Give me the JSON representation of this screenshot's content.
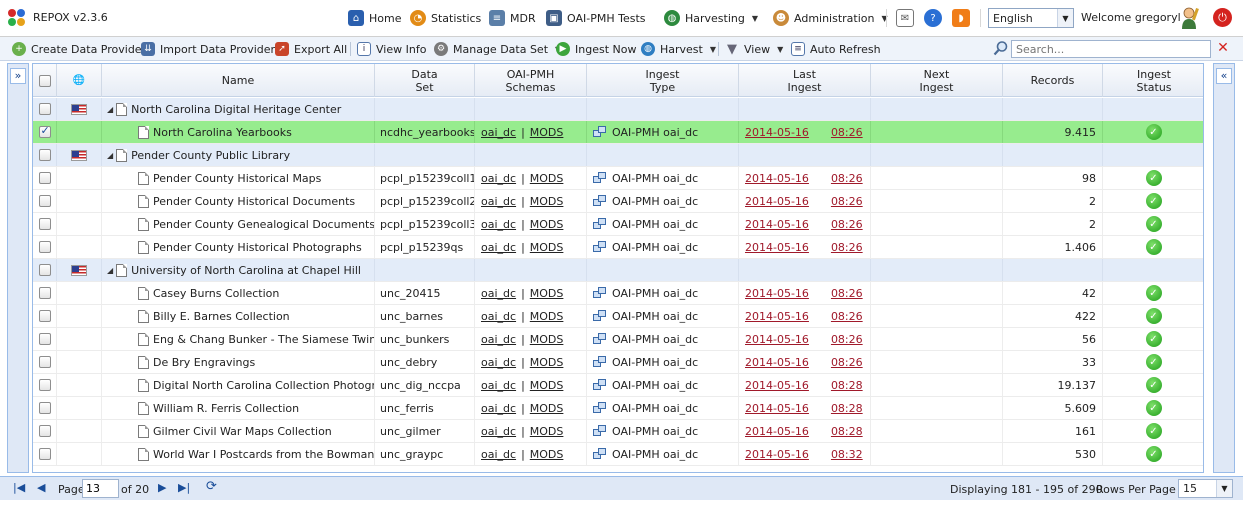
{
  "app": {
    "title": "REPOX v2.3.6"
  },
  "nav": [
    {
      "label": "Home",
      "icon": "home-icon"
    },
    {
      "label": "Statistics",
      "icon": "statistics-icon"
    },
    {
      "label": "MDR",
      "icon": "mdr-icon"
    },
    {
      "label": "OAI-PMH Tests",
      "icon": "oai-tests-icon"
    },
    {
      "label": "Harvesting",
      "icon": "harvesting-icon"
    },
    {
      "label": "Administration",
      "icon": "administration-icon"
    }
  ],
  "language": {
    "selected": "English"
  },
  "user": {
    "welcome": "Welcome gregoryl"
  },
  "toolbar": {
    "create": "Create Data Provider",
    "import": "Import Data Providers",
    "export": "Export All",
    "view_info": "View Info",
    "manage": "Manage Data Set",
    "ingest": "Ingest Now",
    "harvest": "Harvest",
    "view": "View",
    "auto_refresh": "Auto Refresh",
    "search_placeholder": "Search..."
  },
  "columns": {
    "name": "Name",
    "data_set": "Data\nSet",
    "schemas": "OAI-PMH\nSchemas",
    "ingest_type": "Ingest\nType",
    "last_ingest": "Last\nIngest",
    "next_ingest": "Next\nIngest",
    "records": "Records",
    "status": "Ingest\nStatus"
  },
  "rows": [
    {
      "kind": "group",
      "name": "North Carolina Digital Heritage Center"
    },
    {
      "kind": "item",
      "selected": true,
      "name": "North Carolina Yearbooks",
      "set": "ncdhc_yearbooks",
      "schema1": "oai_dc",
      "schema2": "MODS",
      "type": "OAI-PMH oai_dc",
      "date": "2014-05-16",
      "time": "08:26",
      "records": "9.415"
    },
    {
      "kind": "group",
      "name": "Pender County Public Library"
    },
    {
      "kind": "item",
      "name": "Pender County Historical Maps",
      "set": "pcpl_p15239coll1",
      "schema1": "oai_dc",
      "schema2": "MODS",
      "type": "OAI-PMH oai_dc",
      "date": "2014-05-16",
      "time": "08:26",
      "records": "98"
    },
    {
      "kind": "item",
      "name": "Pender County Historical Documents",
      "set": "pcpl_p15239coll2",
      "schema1": "oai_dc",
      "schema2": "MODS",
      "type": "OAI-PMH oai_dc",
      "date": "2014-05-16",
      "time": "08:26",
      "records": "2"
    },
    {
      "kind": "item",
      "name": "Pender County Genealogical Documents",
      "set": "pcpl_p15239coll3",
      "schema1": "oai_dc",
      "schema2": "MODS",
      "type": "OAI-PMH oai_dc",
      "date": "2014-05-16",
      "time": "08:26",
      "records": "2"
    },
    {
      "kind": "item",
      "name": "Pender County Historical Photographs",
      "set": "pcpl_p15239qs",
      "schema1": "oai_dc",
      "schema2": "MODS",
      "type": "OAI-PMH oai_dc",
      "date": "2014-05-16",
      "time": "08:26",
      "records": "1.406"
    },
    {
      "kind": "group",
      "name": "University of North Carolina at Chapel Hill"
    },
    {
      "kind": "item",
      "name": "Casey Burns Collection",
      "set": "unc_20415",
      "schema1": "oai_dc",
      "schema2": "MODS",
      "type": "OAI-PMH oai_dc",
      "date": "2014-05-16",
      "time": "08:26",
      "records": "42"
    },
    {
      "kind": "item",
      "name": "Billy E. Barnes Collection",
      "set": "unc_barnes",
      "schema1": "oai_dc",
      "schema2": "MODS",
      "type": "OAI-PMH oai_dc",
      "date": "2014-05-16",
      "time": "08:26",
      "records": "422"
    },
    {
      "kind": "item",
      "name": "Eng & Chang Bunker - The Siamese Twins",
      "set": "unc_bunkers",
      "schema1": "oai_dc",
      "schema2": "MODS",
      "type": "OAI-PMH oai_dc",
      "date": "2014-05-16",
      "time": "08:26",
      "records": "56"
    },
    {
      "kind": "item",
      "name": "De Bry Engravings",
      "set": "unc_debry",
      "schema1": "oai_dc",
      "schema2": "MODS",
      "type": "OAI-PMH oai_dc",
      "date": "2014-05-16",
      "time": "08:26",
      "records": "33"
    },
    {
      "kind": "item",
      "name": "Digital North Carolina Collection Photographic Archives",
      "set": "unc_dig_nccpa",
      "schema1": "oai_dc",
      "schema2": "MODS",
      "type": "OAI-PMH oai_dc",
      "date": "2014-05-16",
      "time": "08:28",
      "records": "19.137"
    },
    {
      "kind": "item",
      "name": "William R. Ferris Collection",
      "set": "unc_ferris",
      "schema1": "oai_dc",
      "schema2": "MODS",
      "type": "OAI-PMH oai_dc",
      "date": "2014-05-16",
      "time": "08:28",
      "records": "5.609"
    },
    {
      "kind": "item",
      "name": "Gilmer Civil War Maps Collection",
      "set": "unc_gilmer",
      "schema1": "oai_dc",
      "schema2": "MODS",
      "type": "OAI-PMH oai_dc",
      "date": "2014-05-16",
      "time": "08:28",
      "records": "161"
    },
    {
      "kind": "item",
      "name": "World War I Postcards from the Bowman Gray Collection",
      "set": "unc_graypc",
      "schema1": "oai_dc",
      "schema2": "MODS",
      "type": "OAI-PMH oai_dc",
      "date": "2014-05-16",
      "time": "08:32",
      "records": "530"
    }
  ],
  "pager": {
    "page_label": "Page",
    "page": "13",
    "of_label": "of 20",
    "displaying": "Displaying 181 - 195 of 290",
    "rows_label": "Rows Per Page",
    "rows_per_page": "15"
  },
  "colors": {
    "selected_row": "#97ec8e",
    "group_row": "#e3ecf9",
    "link_red": "#a0192a",
    "header_border": "#99bbe8"
  }
}
